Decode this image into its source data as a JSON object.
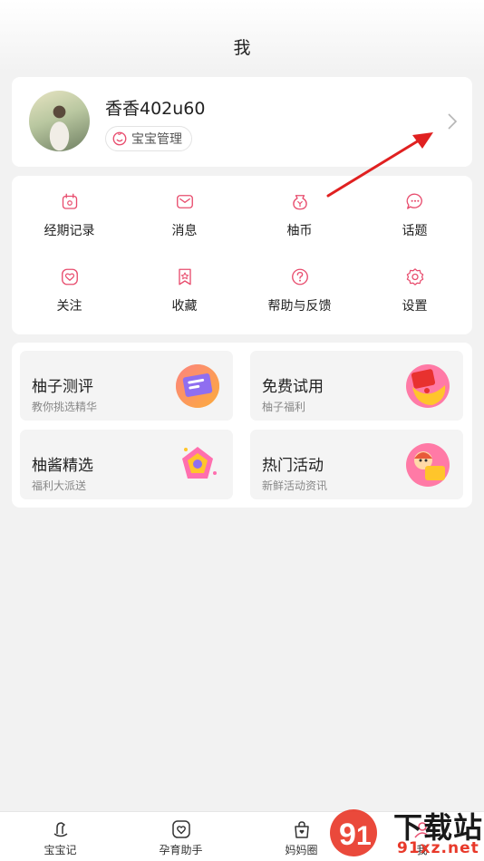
{
  "header": {
    "title": "我"
  },
  "profile": {
    "username": "香香402u60",
    "baby_button": "宝宝管理"
  },
  "menu": {
    "items": [
      {
        "label": "经期记录",
        "icon": "calendar-icon"
      },
      {
        "label": "消息",
        "icon": "mail-icon"
      },
      {
        "label": "柚币",
        "icon": "coin-bag-icon"
      },
      {
        "label": "话题",
        "icon": "chat-bubble-icon"
      },
      {
        "label": "关注",
        "icon": "heart-icon"
      },
      {
        "label": "收藏",
        "icon": "bookmark-star-icon"
      },
      {
        "label": "帮助与反馈",
        "icon": "help-icon"
      },
      {
        "label": "设置",
        "icon": "gear-icon"
      }
    ]
  },
  "tiles": [
    {
      "title": "柚子测评",
      "subtitle": "教你挑选精华"
    },
    {
      "title": "免费试用",
      "subtitle": "柚子福利"
    },
    {
      "title": "柚酱精选",
      "subtitle": "福利大派送"
    },
    {
      "title": "热门活动",
      "subtitle": "新鲜活动资讯"
    }
  ],
  "tabbar": {
    "tabs": [
      {
        "label": "宝宝记"
      },
      {
        "label": "孕育助手"
      },
      {
        "label": "妈妈圈"
      },
      {
        "label": "我"
      }
    ]
  },
  "watermark": {
    "text": "下载站",
    "url_text": "91xz.net"
  },
  "colors": {
    "accent": "#e84d6e",
    "background": "#f2f2f2",
    "annotation_arrow": "#e02020"
  }
}
